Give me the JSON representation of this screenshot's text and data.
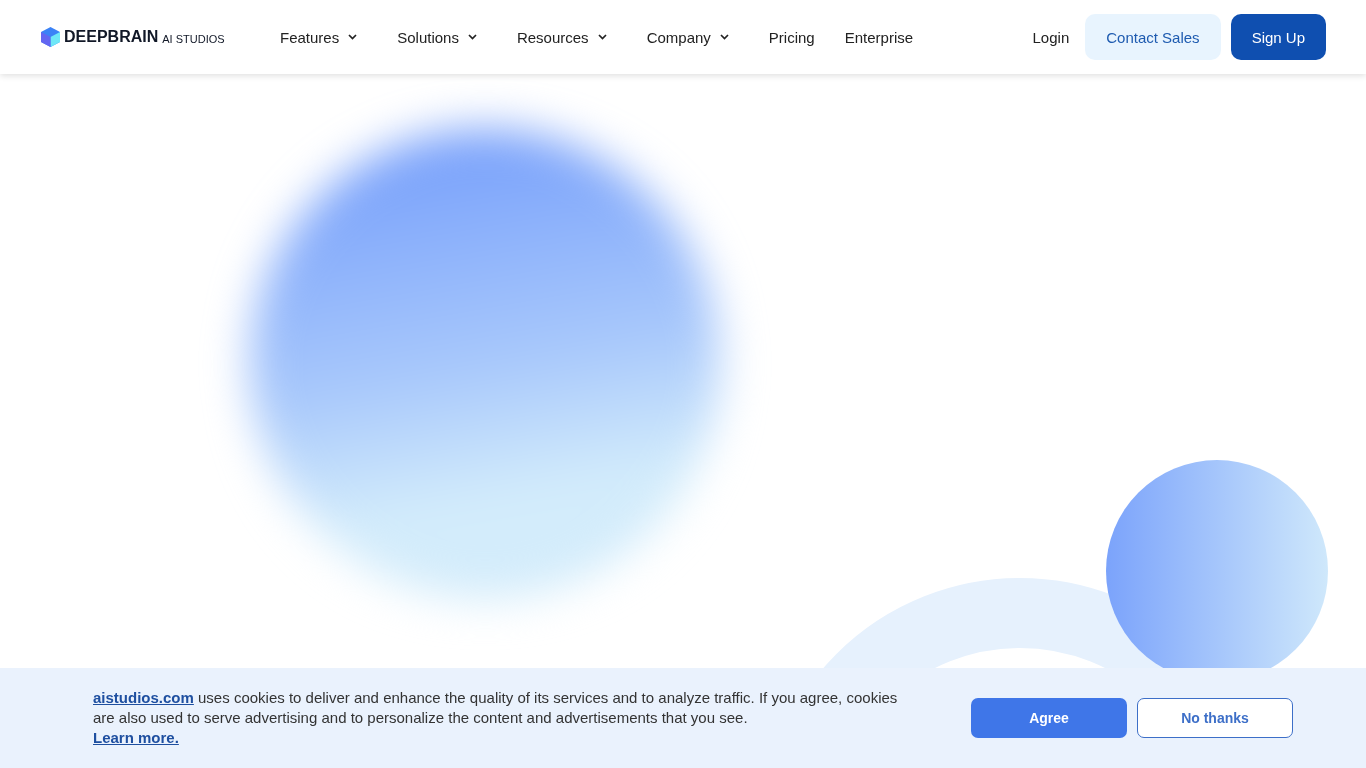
{
  "header": {
    "logo": {
      "brand": "DEEPBRAIN",
      "product": "AI STUDIOS"
    },
    "nav": [
      {
        "label": "Features",
        "kind": "dropdown"
      },
      {
        "label": "Solutions",
        "kind": "dropdown"
      },
      {
        "label": "Resources",
        "kind": "dropdown"
      },
      {
        "label": "Company",
        "kind": "dropdown"
      },
      {
        "label": "Pricing",
        "kind": "link"
      },
      {
        "label": "Enterprise",
        "kind": "link"
      }
    ],
    "login": "Login",
    "contact_sales": "Contact Sales",
    "sign_up": "Sign Up"
  },
  "cookie_banner": {
    "site_link": "aistudios.com",
    "message": " uses cookies to deliver and enhance the quality of its services and to analyze traffic. If you agree, cookies are also used to serve advertising and to personalize the content and advertisements that you see.",
    "learn_more": "Learn more.",
    "agree": "Agree",
    "decline": "No thanks"
  }
}
